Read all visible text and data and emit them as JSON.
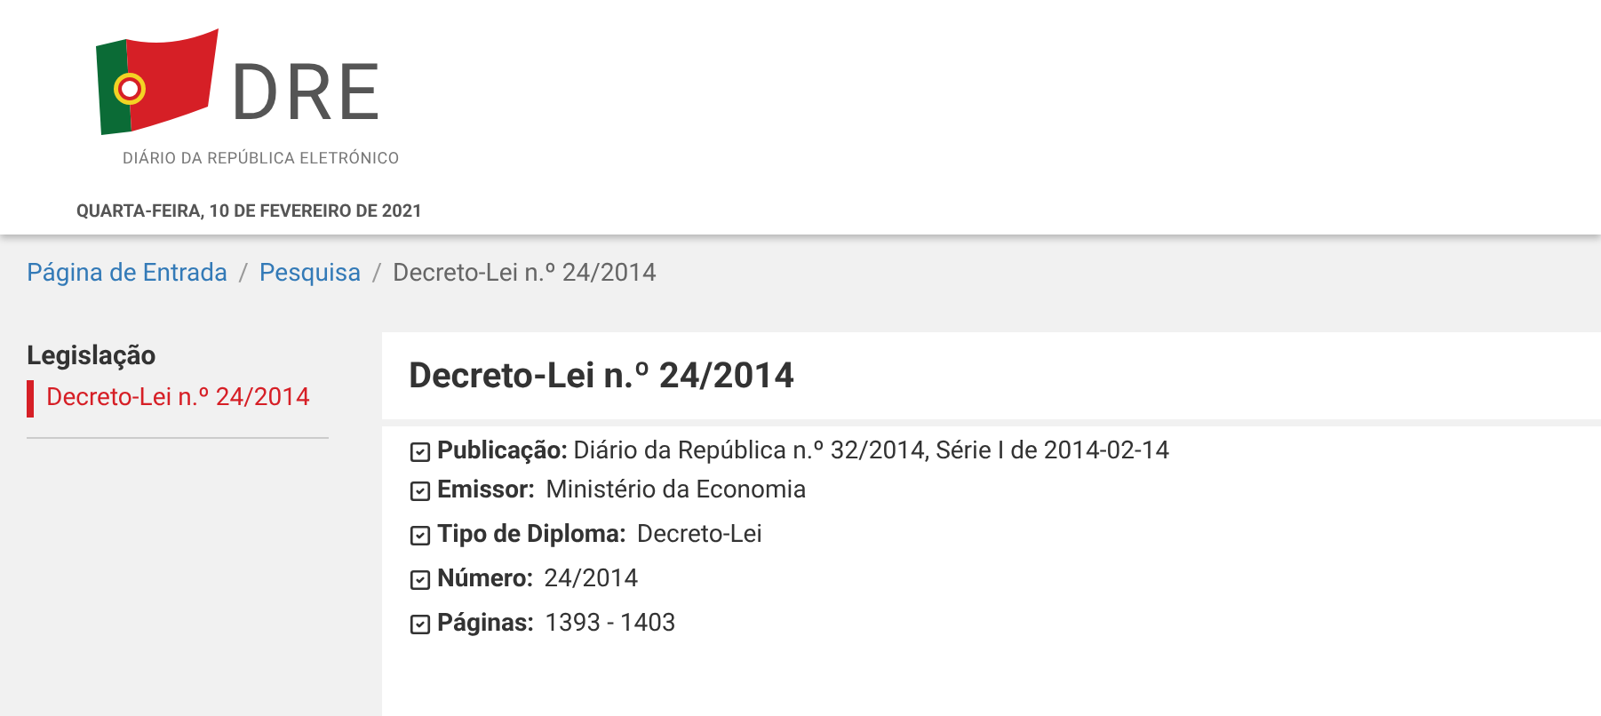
{
  "header": {
    "logo_text": "DRE",
    "logo_subtitle": "DIÁRIO DA REPÚBLICA ELETRÓNICO",
    "date": "QUARTA-FEIRA, 10 DE FEVEREIRO DE 2021"
  },
  "breadcrumb_separator": "/",
  "breadcrumb": [
    {
      "label": "Página de Entrada",
      "kind": "link"
    },
    {
      "label": "Pesquisa",
      "kind": "link"
    },
    {
      "label": "Decreto-Lei n.º 24/2014",
      "kind": "current"
    }
  ],
  "sidebar": {
    "title": "Legislação",
    "items": [
      {
        "label": "Decreto-Lei n.º 24/2014",
        "selected": true
      }
    ]
  },
  "document": {
    "title": "Decreto-Lei n.º 24/2014",
    "fields": [
      {
        "label": "Publicação:",
        "value": "Diário da República n.º 32/2014, Série I de 2014-02-14"
      },
      {
        "label": "Emissor:",
        "value": "Ministério da Economia"
      },
      {
        "label": "Tipo de Diploma:",
        "value": "Decreto-Lei"
      },
      {
        "label": "Número:",
        "value": "24/2014"
      },
      {
        "label": "Páginas:",
        "value": "1393 - 1403"
      }
    ]
  }
}
